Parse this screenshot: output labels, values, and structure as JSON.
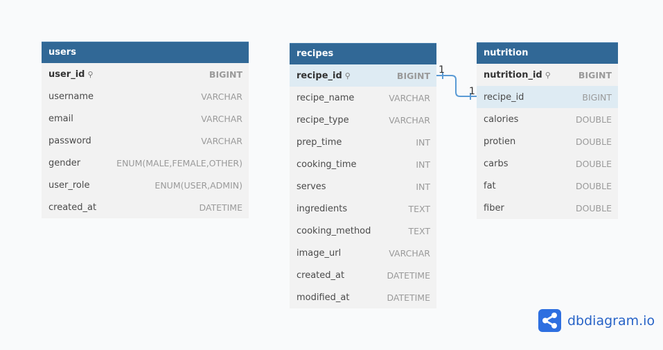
{
  "tables": [
    {
      "id": "users",
      "name": "users",
      "fields": [
        {
          "name": "user_id",
          "type": "BIGINT",
          "pk": true
        },
        {
          "name": "username",
          "type": "VARCHAR"
        },
        {
          "name": "email",
          "type": "VARCHAR"
        },
        {
          "name": "password",
          "type": "VARCHAR"
        },
        {
          "name": "gender",
          "type": "ENUM(MALE,FEMALE,OTHER)"
        },
        {
          "name": "user_role",
          "type": "ENUM(USER,ADMIN)"
        },
        {
          "name": "created_at",
          "type": "DATETIME"
        }
      ]
    },
    {
      "id": "recipes",
      "name": "recipes",
      "fields": [
        {
          "name": "recipe_id",
          "type": "BIGINT",
          "pk": true,
          "highlight": true
        },
        {
          "name": "recipe_name",
          "type": "VARCHAR"
        },
        {
          "name": "recipe_type",
          "type": "VARCHAR"
        },
        {
          "name": "prep_time",
          "type": "INT"
        },
        {
          "name": "cooking_time",
          "type": "INT"
        },
        {
          "name": "serves",
          "type": "INT"
        },
        {
          "name": "ingredients",
          "type": "TEXT"
        },
        {
          "name": "cooking_method",
          "type": "TEXT"
        },
        {
          "name": "image_url",
          "type": "VARCHAR"
        },
        {
          "name": "created_at",
          "type": "DATETIME"
        },
        {
          "name": "modified_at",
          "type": "DATETIME"
        }
      ]
    },
    {
      "id": "nutrition",
      "name": "nutrition",
      "fields": [
        {
          "name": "nutrition_id",
          "type": "BIGINT",
          "pk": true
        },
        {
          "name": "recipe_id",
          "type": "BIGINT",
          "highlight": true
        },
        {
          "name": "calories",
          "type": "DOUBLE"
        },
        {
          "name": "protien",
          "type": "DOUBLE"
        },
        {
          "name": "carbs",
          "type": "DOUBLE"
        },
        {
          "name": "fat",
          "type": "DOUBLE"
        },
        {
          "name": "fiber",
          "type": "DOUBLE"
        }
      ]
    }
  ],
  "relation": {
    "from": "recipes.recipe_id",
    "to": "nutrition.recipe_id",
    "from_card": "1",
    "to_card": "1",
    "color": "#5b9bd5"
  },
  "logo": {
    "text": "dbdiagram.io",
    "icon": "share-nodes-icon"
  },
  "colors": {
    "header": "#316896",
    "highlight": "#deebf3"
  }
}
